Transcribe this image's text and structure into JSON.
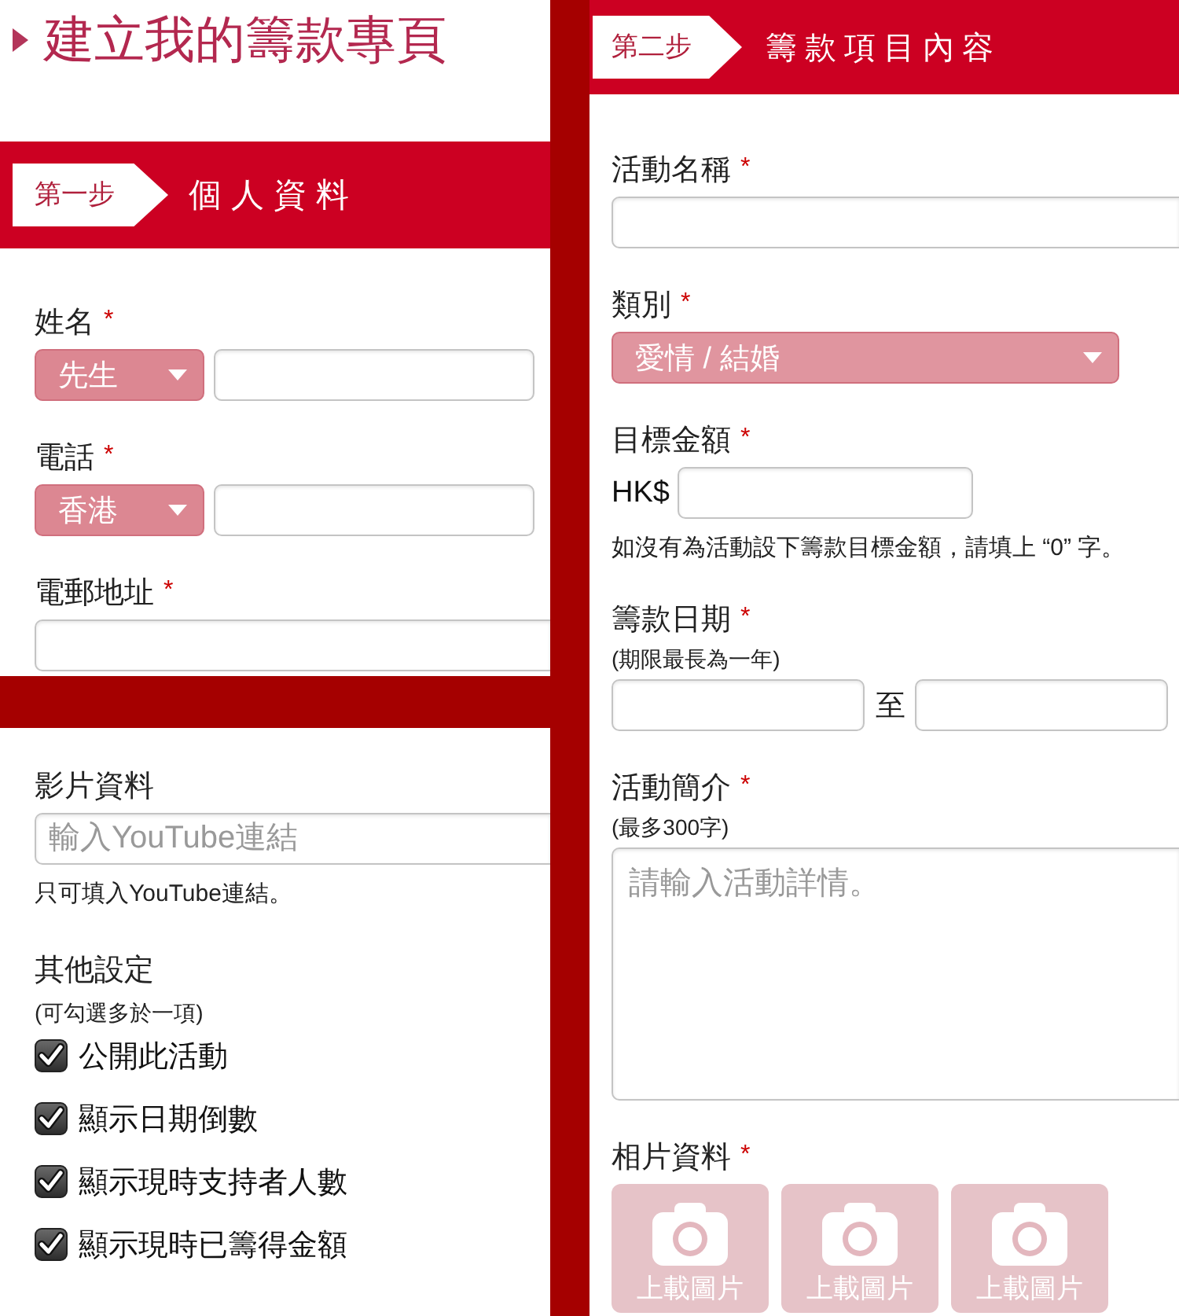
{
  "page_title": "建立我的籌款專頁",
  "step_1": {
    "badge": "第一步",
    "title": "個人資料",
    "fields": [
      {
        "kind": "select_text",
        "label": "姓名",
        "mark": "*",
        "select": "先生"
      },
      {
        "kind": "select_text",
        "label": "電話",
        "mark": "*",
        "select": "香港"
      },
      {
        "kind": "text",
        "label": "電郵地址",
        "mark": "*"
      }
    ]
  },
  "media": {
    "fields": [
      {
        "kind": "text",
        "label": "影片資料",
        "placeholder": "輸入YouTube連結",
        "hint": "只可填入YouTube連結。"
      }
    ]
  },
  "other_settings": {
    "label": "其他設定",
    "note": "(可勾選多於一項)",
    "items": [
      {
        "label": "公開此活動",
        "checked": true
      },
      {
        "label": "顯示日期倒數",
        "checked": true
      },
      {
        "label": "顯示現時支持者人數",
        "checked": true
      },
      {
        "label": "顯示現時已籌得金額",
        "checked": true
      }
    ]
  },
  "step_2": {
    "badge": "第二步",
    "title": "籌款項目內容",
    "fields": [
      {
        "kind": "text",
        "label": "活動名稱",
        "mark": "*"
      },
      {
        "kind": "select",
        "label": "類別",
        "mark": "*",
        "select": "愛情 / 結婚"
      },
      {
        "kind": "currency",
        "label": "目標金額",
        "mark": "*",
        "prefix": "HK$",
        "hint": "如沒有為活動設下籌款目標金額，請填上 “0” 字。"
      },
      {
        "kind": "date_range",
        "label": "籌款日期",
        "mark": "*",
        "note": "(期限最長為一年)",
        "separator": "至"
      },
      {
        "kind": "textarea",
        "label": "活動簡介",
        "mark": "*",
        "note": "(最多300字)",
        "placeholder": "請輸入活動詳情。"
      },
      {
        "kind": "upload",
        "label": "相片資料",
        "mark": "*",
        "tiles": [
          {
            "label": "上載圖片"
          },
          {
            "label": "上載圖片"
          },
          {
            "label": "上載圖片"
          }
        ]
      }
    ]
  }
}
